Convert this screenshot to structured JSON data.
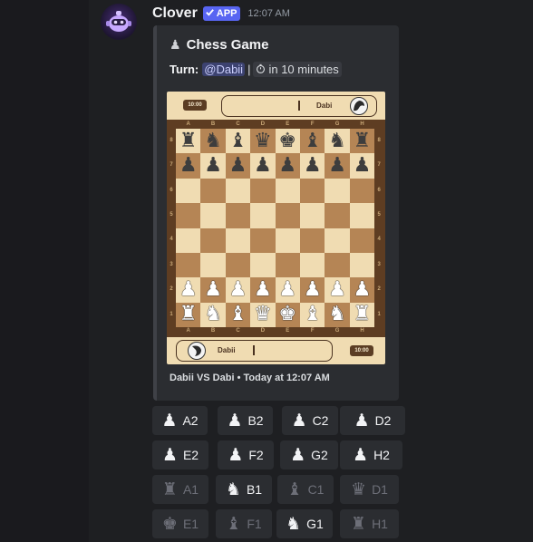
{
  "message": {
    "author": "Clover",
    "badge": "APP",
    "timestamp": "12:07 AM"
  },
  "embed": {
    "title": "Chess Game",
    "turn_label": "Turn:",
    "mention": "@Dabii",
    "separator": "|",
    "time_chip": "in 10 minutes",
    "footer": "Dabii VS Dabi • Today at 12:07 AM"
  },
  "board": {
    "top_player": {
      "name": "Dabi",
      "clock": "10:00"
    },
    "bottom_player": {
      "name": "Dabii",
      "clock": "10:00"
    },
    "files": [
      "A",
      "B",
      "C",
      "D",
      "E",
      "F",
      "G",
      "H"
    ],
    "ranks": [
      "8",
      "7",
      "6",
      "5",
      "4",
      "3",
      "2",
      "1"
    ],
    "position": [
      [
        "r",
        "n",
        "b",
        "q",
        "k",
        "b",
        "n",
        "r"
      ],
      [
        "p",
        "p",
        "p",
        "p",
        "p",
        "p",
        "p",
        "p"
      ],
      [
        "",
        "",
        "",
        "",
        "",
        "",
        "",
        ""
      ],
      [
        "",
        "",
        "",
        "",
        "",
        "",
        "",
        ""
      ],
      [
        "",
        "",
        "",
        "",
        "",
        "",
        "",
        ""
      ],
      [
        "",
        "",
        "",
        "",
        "",
        "",
        "",
        ""
      ],
      [
        "P",
        "P",
        "P",
        "P",
        "P",
        "P",
        "P",
        "P"
      ],
      [
        "R",
        "N",
        "B",
        "Q",
        "K",
        "B",
        "N",
        "R"
      ]
    ],
    "colors": {
      "light": "#f0dcb2",
      "dark": "#b58555",
      "frame": "#5e3d22",
      "black_piece": "#3d3d3d",
      "white_piece": "#ffffff"
    }
  },
  "buttons": [
    {
      "piece": "pawn-icon",
      "glyph": "♟",
      "label": "A2",
      "disabled": false
    },
    {
      "piece": "pawn-icon",
      "glyph": "♟",
      "label": "B2",
      "disabled": false
    },
    {
      "piece": "pawn-icon",
      "glyph": "♟",
      "label": "C2",
      "disabled": false
    },
    {
      "piece": "pawn-icon",
      "glyph": "♟",
      "label": "D2",
      "disabled": false
    },
    {
      "piece": "pawn-icon",
      "glyph": "♟",
      "label": "E2",
      "disabled": false
    },
    {
      "piece": "pawn-icon",
      "glyph": "♟",
      "label": "F2",
      "disabled": false
    },
    {
      "piece": "pawn-icon",
      "glyph": "♟",
      "label": "G2",
      "disabled": false
    },
    {
      "piece": "pawn-icon",
      "glyph": "♟",
      "label": "H2",
      "disabled": false
    },
    {
      "piece": "rook-icon",
      "glyph": "♜",
      "label": "A1",
      "disabled": true
    },
    {
      "piece": "knight-icon",
      "glyph": "♞",
      "label": "B1",
      "disabled": false
    },
    {
      "piece": "bishop-icon",
      "glyph": "♝",
      "label": "C1",
      "disabled": true
    },
    {
      "piece": "queen-icon",
      "glyph": "♛",
      "label": "D1",
      "disabled": true
    },
    {
      "piece": "king-icon",
      "glyph": "♚",
      "label": "E1",
      "disabled": true
    },
    {
      "piece": "bishop-icon",
      "glyph": "♝",
      "label": "F1",
      "disabled": true
    },
    {
      "piece": "knight-icon",
      "glyph": "♞",
      "label": "G1",
      "disabled": false
    },
    {
      "piece": "rook-icon",
      "glyph": "♜",
      "label": "H1",
      "disabled": true
    }
  ]
}
